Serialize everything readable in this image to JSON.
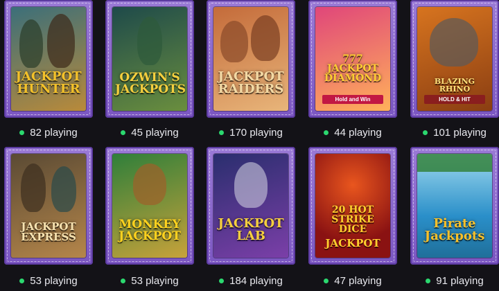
{
  "games": [
    {
      "title_l1": "JACKPOT",
      "title_l2": "HUNTER",
      "subtitle": "",
      "players": "82 playing",
      "bg": [
        "#3b6f7a",
        "#b98a3a"
      ],
      "title_color": "#f3c12a"
    },
    {
      "title_l1": "OZWIN'S",
      "title_l2": "JACKPOTS",
      "subtitle": "",
      "players": "45 playing",
      "bg": [
        "#1e4a4a",
        "#6a8e3e"
      ],
      "title_color": "#f5cf3e"
    },
    {
      "title_l1": "JACKPOT",
      "title_l2": "RAIDERS",
      "subtitle": "",
      "players": "170 playing",
      "bg": [
        "#c46b3a",
        "#e8b57a"
      ],
      "title_color": "#f3d9a4"
    },
    {
      "title_l1": "777 JACKPOT",
      "title_l2": "DIAMOND",
      "subtitle": "Hold and Win",
      "players": "44 playing",
      "bg": [
        "#e0467a",
        "#ffb15a"
      ],
      "title_color": "#ffcc33"
    },
    {
      "title_l1": "BLAZING RHINO",
      "title_l2": "",
      "subtitle": "HOLD & HIT",
      "players": "101 playing",
      "bg": [
        "#d7741f",
        "#8a3e12"
      ],
      "title_color": "#ffe07a"
    },
    {
      "title_l1": "JACKPOT",
      "title_l2": "EXPRESS",
      "subtitle": "",
      "players": "53 playing",
      "bg": [
        "#5a4a34",
        "#b5864a"
      ],
      "title_color": "#f6e2b0"
    },
    {
      "title_l1": "MONKEY",
      "title_l2": "JACKPOT",
      "subtitle": "",
      "players": "53 playing",
      "bg": [
        "#2f7f3a",
        "#c7a23a"
      ],
      "title_color": "#ffd21e"
    },
    {
      "title_l1": "JACKPOT",
      "title_l2": "LAB",
      "subtitle": "",
      "players": "184 playing",
      "bg": [
        "#2a2e6e",
        "#7b3fa8"
      ],
      "title_color": "#f5cf3e"
    },
    {
      "title_l1": "20 HOT",
      "title_l2": "STRIKE DICE",
      "subtitle": "JACKPOT",
      "players": "47 playing",
      "bg": [
        "#8a1212",
        "#e9561e"
      ],
      "title_color": "#ffcf2e"
    },
    {
      "title_l1": "Pirate",
      "title_l2": "Jackpots",
      "subtitle": "",
      "players": "91 playing",
      "bg": [
        "#2a8fc9",
        "#9fd9ee"
      ],
      "title_color": "#f7c02a"
    }
  ],
  "colors": {
    "frame": "#8a66cf",
    "background": "#131217",
    "online_dot": "#2bd86f"
  }
}
